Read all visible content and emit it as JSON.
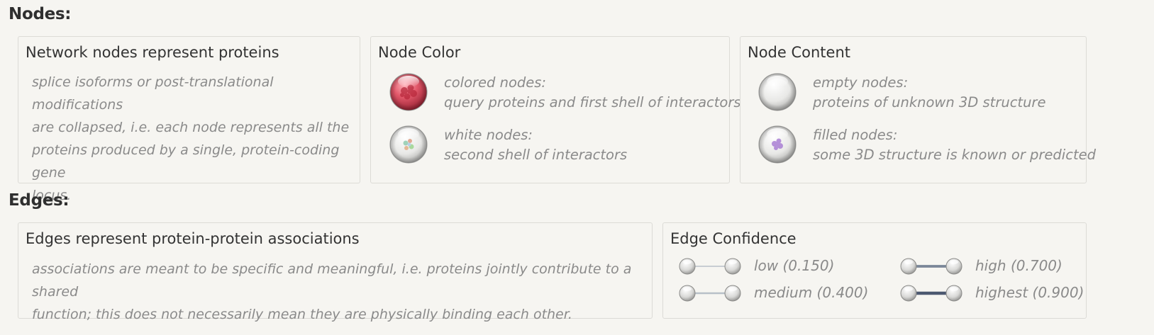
{
  "nodes_section": {
    "title": "Nodes:",
    "proteins_box": {
      "title": "Network nodes represent proteins",
      "desc_lines": [
        "splice isoforms or post-translational modifications",
        "are collapsed, i.e. each node represents all the",
        "proteins produced by a single, protein-coding gene",
        "locus."
      ]
    },
    "color_box": {
      "title": "Node Color",
      "items": [
        {
          "label": "colored nodes:",
          "desc": "query proteins and first shell of interactors",
          "icon": "colored-node-icon"
        },
        {
          "label": "white nodes:",
          "desc": "second shell of interactors",
          "icon": "white-node-icon"
        }
      ]
    },
    "content_box": {
      "title": "Node Content",
      "items": [
        {
          "label": "empty nodes:",
          "desc": "proteins of unknown 3D structure",
          "icon": "empty-node-icon"
        },
        {
          "label": "filled nodes:",
          "desc": "some 3D structure is known or predicted",
          "icon": "filled-node-icon"
        }
      ]
    }
  },
  "edges_section": {
    "title": "Edges:",
    "assoc_box": {
      "title": "Edges represent protein-protein associations",
      "desc_lines": [
        "associations are meant to be specific and meaningful, i.e. proteins jointly contribute to a shared",
        "function; this does not necessarily mean they are physically binding each other."
      ]
    },
    "confidence_box": {
      "title": "Edge Confidence",
      "levels": [
        {
          "label": "low (0.150)",
          "value": 0.15
        },
        {
          "label": "medium (0.400)",
          "value": 0.4
        },
        {
          "label": "high (0.700)",
          "value": 0.7
        },
        {
          "label": "highest (0.900)",
          "value": 0.9
        }
      ]
    }
  },
  "colors": {
    "background": "#f6f5f1",
    "border": "#dcdbd6",
    "muted_text": "#8a8a8a",
    "colored_node": "#d64a5c",
    "filled_node_structure": "#a070d0"
  }
}
